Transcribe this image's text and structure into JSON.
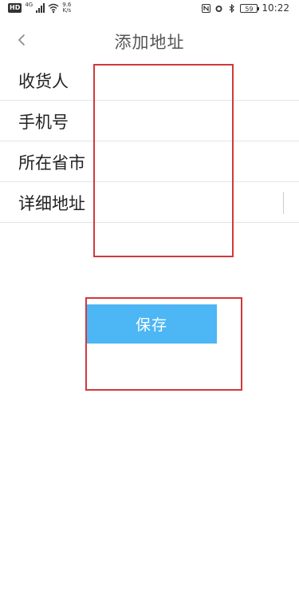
{
  "status_bar": {
    "hd": "HD",
    "signal_type": "4G",
    "speed_value": "9.6",
    "speed_unit": "K/s",
    "battery": "59",
    "time": "10:22"
  },
  "header": {
    "back_icon": "chevron-left-icon",
    "title": "添加地址"
  },
  "form": {
    "fields": [
      {
        "label": "收货人",
        "value": "",
        "placeholder": ""
      },
      {
        "label": "手机号",
        "value": "",
        "placeholder": ""
      },
      {
        "label": "所在省市",
        "value": "",
        "placeholder": ""
      },
      {
        "label": "详细地址",
        "value": "",
        "placeholder": ""
      }
    ]
  },
  "actions": {
    "save_label": "保存"
  },
  "colors": {
    "accent": "#4db6f5",
    "highlight": "#d0393b",
    "divider": "#e4e4e4"
  }
}
